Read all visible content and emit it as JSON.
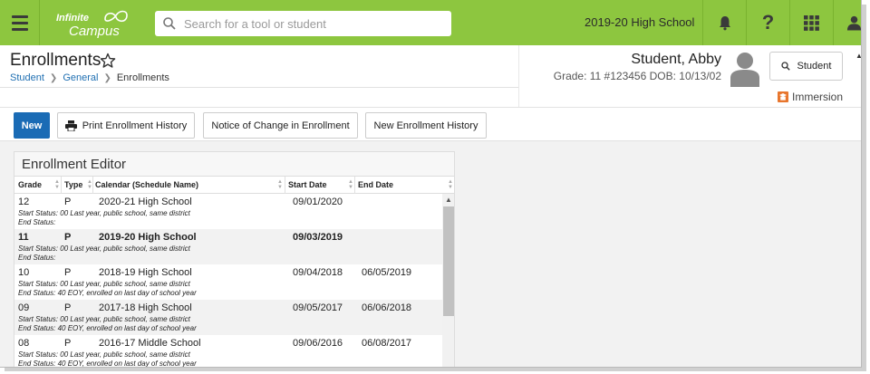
{
  "topbar": {
    "logo_line1": "Infinite",
    "logo_line2": "Campus",
    "search_placeholder": "Search for a tool or student",
    "school_year": "2019-20 High School",
    "icons": [
      "menu-icon",
      "bell-icon",
      "help-icon",
      "apps-grid-icon",
      "user-icon"
    ]
  },
  "header": {
    "title": "Enrollments",
    "breadcrumb": [
      "Student",
      "General",
      "Enrollments"
    ]
  },
  "student": {
    "name": "Student, Abby",
    "info": "Grade: 11 #123456 DOB: 10/13/02",
    "button_label": "Student",
    "immersion_label": "Immersion"
  },
  "actions": {
    "new": "New",
    "print": "Print Enrollment History",
    "notice": "Notice of Change in Enrollment",
    "new_history": "New Enrollment History"
  },
  "editor": {
    "title": "Enrollment Editor",
    "columns": [
      "Grade",
      "Type",
      "Calendar (Schedule Name)",
      "Start Date",
      "End Date"
    ],
    "start_status_label": "Start Status:",
    "end_status_label": "End Status:",
    "rows": [
      {
        "grade": "12",
        "type": "P",
        "calendar": "2020-21 High School",
        "start": "09/01/2020",
        "end": "",
        "start_status": "00 Last year, public school, same district",
        "end_status": ""
      },
      {
        "grade": "11",
        "type": "P",
        "calendar": "2019-20 High School",
        "start": "09/03/2019",
        "end": "",
        "start_status": "00 Last year, public school, same district",
        "end_status": ""
      },
      {
        "grade": "10",
        "type": "P",
        "calendar": "2018-19 High School",
        "start": "09/04/2018",
        "end": "06/05/2019",
        "start_status": "00 Last year, public school, same district",
        "end_status": "40 EOY, enrolled on last day of school year"
      },
      {
        "grade": "09",
        "type": "P",
        "calendar": "2017-18 High School",
        "start": "09/05/2017",
        "end": "06/06/2018",
        "start_status": "00 Last year, public school, same district",
        "end_status": "40 EOY, enrolled on last day of school year"
      },
      {
        "grade": "08",
        "type": "P",
        "calendar": "2016-17 Middle School",
        "start": "09/06/2016",
        "end": "06/08/2017",
        "start_status": "00 Last year, public school, same district",
        "end_status": "40 EOY, enrolled on last day of school year"
      }
    ]
  },
  "colors": {
    "topbar": "#8dc63f",
    "primary_button": "#1a6bb5",
    "link": "#1f6fb2",
    "immersion_icon": "#e8762d"
  }
}
